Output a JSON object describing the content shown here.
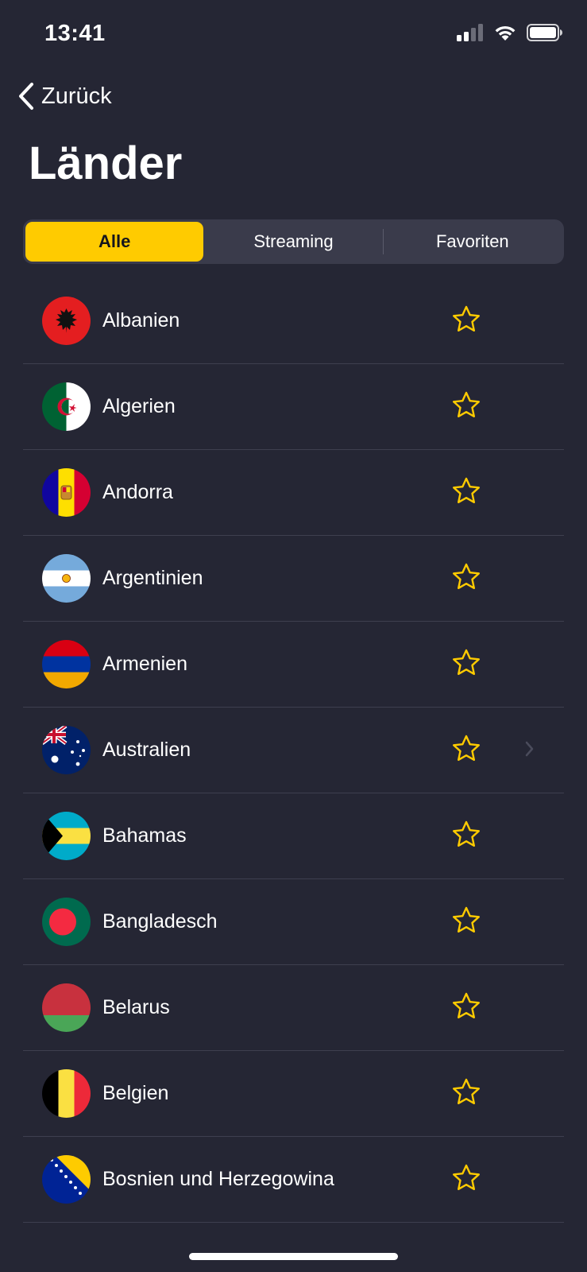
{
  "status_bar": {
    "time": "13:41",
    "icons": [
      "signal-icon",
      "wifi-icon",
      "battery-icon"
    ]
  },
  "nav": {
    "back_label": "Zurück",
    "back_icon": "chevron-left-icon"
  },
  "page": {
    "title": "Länder"
  },
  "segments": [
    {
      "label": "Alle",
      "selected": true
    },
    {
      "label": "Streaming",
      "selected": false
    },
    {
      "label": "Favoriten",
      "selected": false
    }
  ],
  "colors": {
    "background": "#252634",
    "accent": "#ffcb00",
    "star": "#ffcb00",
    "segment_bg": "#3a3b4b"
  },
  "countries": [
    {
      "name": "Albanien",
      "flag": "albania-flag-icon",
      "favorite": false
    },
    {
      "name": "Algerien",
      "flag": "algeria-flag-icon",
      "favorite": false
    },
    {
      "name": "Andorra",
      "flag": "andorra-flag-icon",
      "favorite": false
    },
    {
      "name": "Argentinien",
      "flag": "argentina-flag-icon",
      "favorite": false
    },
    {
      "name": "Armenien",
      "flag": "armenia-flag-icon",
      "favorite": false
    },
    {
      "name": "Australien",
      "flag": "australia-flag-icon",
      "favorite": false,
      "has_chevron": true
    },
    {
      "name": "Bahamas",
      "flag": "bahamas-flag-icon",
      "favorite": false
    },
    {
      "name": "Bangladesch",
      "flag": "bangladesh-flag-icon",
      "favorite": false
    },
    {
      "name": "Belarus",
      "flag": "belarus-flag-icon",
      "favorite": false
    },
    {
      "name": "Belgien",
      "flag": "belgium-flag-icon",
      "favorite": false
    },
    {
      "name": "Bosnien und Herzegowina",
      "flag": "bosnia-flag-icon",
      "favorite": false
    }
  ]
}
